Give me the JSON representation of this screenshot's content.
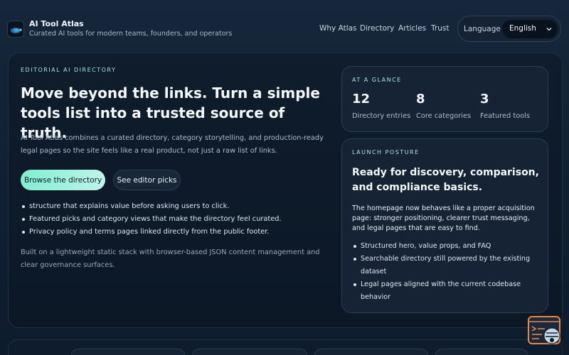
{
  "header": {
    "brand_title": "AI Tool Atlas",
    "brand_subtitle": "Curated AI tools for modern teams, founders, and operators",
    "nav": [
      "Why Atlas",
      "Directory",
      "Articles",
      "Trust"
    ],
    "language_label": "Language",
    "language_selected": "English"
  },
  "hero": {
    "eyebrow": "EDITORIAL AI DIRECTORY",
    "headline": "Move beyond the links. Turn a simple tools list into a trusted source of truth.",
    "description": "AI Tool Atlas combines a curated directory, category storytelling, and production-ready legal pages so the site feels like a real product, not just a raw list of links.",
    "primary_button": "Browse the directory",
    "secondary_button": "See editor picks",
    "bullets": [
      "structure that explains value before asking users to click.",
      "Featured picks and category views that make the directory feel curated.",
      "Privacy policy and terms pages linked directly from the public footer."
    ],
    "footnote": "Built on a lightweight static stack with browser-based JSON content management and clear governance surfaces."
  },
  "glance": {
    "label": "AT A GLANCE",
    "stats": [
      {
        "value": "12",
        "label": "Directory entries"
      },
      {
        "value": "8",
        "label": "Core categories"
      },
      {
        "value": "3",
        "label": "Featured tools"
      }
    ]
  },
  "launch": {
    "label": "LAUNCH POSTURE",
    "title": "Ready for discovery, comparison, and compliance basics.",
    "description": "The homepage now behaves like a proper acquisition page: stronger positioning, clearer trust messaging, and legal pages that are easy to find.",
    "bullets": [
      "Structured hero, value props, and FAQ",
      "Searchable directory still powered by the existing dataset",
      "Legal pages aligned with the current codebase behavior"
    ]
  },
  "colors": {
    "accent": "#7ef0cf",
    "background": "#102032",
    "widget_orange": "#e8874a"
  },
  "icons": {
    "logo": "atlas-logo-icon",
    "chevron": "chevron-down-icon",
    "widget": "terminal-chat-widget-icon"
  }
}
